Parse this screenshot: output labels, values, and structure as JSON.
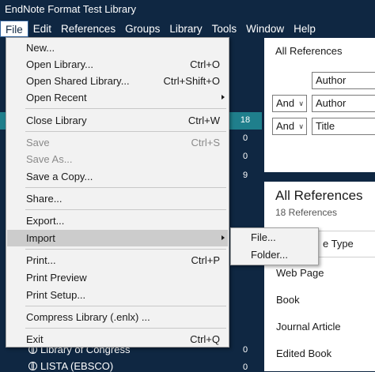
{
  "window": {
    "title": "EndNote Format Test Library"
  },
  "menubar": [
    "File",
    "Edit",
    "References",
    "Groups",
    "Library",
    "Tools",
    "Window",
    "Help"
  ],
  "file_menu": {
    "new": "New...",
    "open_library": "Open Library...",
    "open_library_sc": "Ctrl+O",
    "open_shared": "Open Shared Library...",
    "open_shared_sc": "Ctrl+Shift+O",
    "open_recent": "Open Recent",
    "close_library": "Close Library",
    "close_library_sc": "Ctrl+W",
    "save": "Save",
    "save_sc": "Ctrl+S",
    "save_as": "Save As...",
    "save_copy": "Save a Copy...",
    "share": "Share...",
    "export": "Export...",
    "import": "Import",
    "print": "Print...",
    "print_sc": "Ctrl+P",
    "print_preview": "Print Preview",
    "print_setup": "Print Setup...",
    "compress": "Compress Library (.enlx) ...",
    "exit": "Exit",
    "exit_sc": "Ctrl+Q"
  },
  "import_submenu": {
    "file": "File...",
    "folder": "Folder..."
  },
  "sidebar": {
    "counts": [
      "18",
      "0",
      "0",
      "9",
      "0",
      "0"
    ],
    "groups": [
      "Library of Congress",
      "LISTA (EBSCO)"
    ]
  },
  "search": {
    "header": "All References",
    "row1_field": "Author",
    "row2_op": "And",
    "row2_field": "Author",
    "row3_op": "And",
    "row3_field": "Title"
  },
  "references": {
    "title": "All References",
    "count": "18 References",
    "column": "e Type",
    "rows": [
      "Web Page",
      "Book",
      "Journal Article",
      "Edited Book"
    ]
  }
}
